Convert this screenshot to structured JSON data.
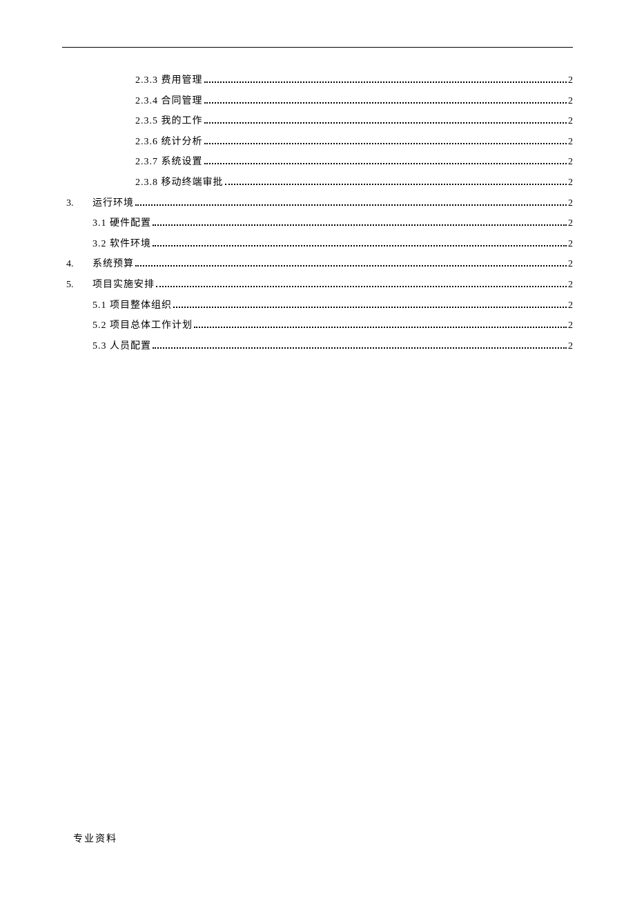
{
  "toc": {
    "entries": [
      {
        "level": 3,
        "num": "",
        "label": "2.3.3  费用管理",
        "page": "2"
      },
      {
        "level": 3,
        "num": "",
        "label": "2.3.4  合同管理",
        "page": "2"
      },
      {
        "level": 3,
        "num": "",
        "label": "2.3.5  我的工作",
        "page": "2"
      },
      {
        "level": 3,
        "num": "",
        "label": "2.3.6  统计分析",
        "page": "2"
      },
      {
        "level": 3,
        "num": "",
        "label": "2.3.7  系统设置",
        "page": "2"
      },
      {
        "level": 3,
        "num": "",
        "label": "2.3.8 移动终端审批",
        "page": "2"
      },
      {
        "level": 1,
        "num": "3.",
        "label": "运行环境",
        "page": "2"
      },
      {
        "level": 2,
        "num": "",
        "label": "3.1 硬件配置",
        "page": "2"
      },
      {
        "level": 2,
        "num": "",
        "label": "3.2 软件环境",
        "page": "2"
      },
      {
        "level": 1,
        "num": "4.",
        "label": "系统预算",
        "page": "2"
      },
      {
        "level": 1,
        "num": "5.",
        "label": "项目实施安排",
        "page": "2"
      },
      {
        "level": 2,
        "num": "",
        "label": "5.1 项目整体组织",
        "page": "2"
      },
      {
        "level": 2,
        "num": "",
        "label": "5.2 项目总体工作计划",
        "page": "2"
      },
      {
        "level": 2,
        "num": "",
        "label": "5.3 人员配置",
        "page": "2"
      }
    ]
  },
  "footer": "专业资料"
}
